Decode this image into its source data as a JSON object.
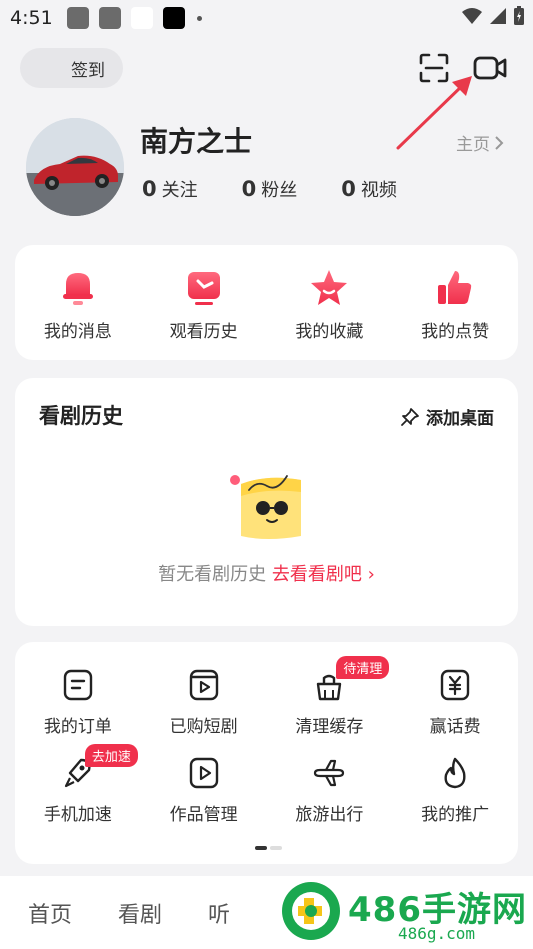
{
  "status_bar": {
    "time": "4:51"
  },
  "header": {
    "checkin_label": "签到"
  },
  "profile": {
    "username": "南方之士",
    "homepage_label": "主页",
    "stats": [
      {
        "value": "0",
        "label": "关注"
      },
      {
        "value": "0",
        "label": "粉丝"
      },
      {
        "value": "0",
        "label": "视频"
      }
    ]
  },
  "quick_actions": [
    {
      "label": "我的消息",
      "icon": "bell-icon"
    },
    {
      "label": "观看历史",
      "icon": "history-clock-icon"
    },
    {
      "label": "我的收藏",
      "icon": "star-icon"
    },
    {
      "label": "我的点赞",
      "icon": "thumbs-up-icon"
    }
  ],
  "history": {
    "title": "看剧历史",
    "add_desktop_label": "添加桌面",
    "empty_text": "暂无看剧历史",
    "go_link": "去看看剧吧"
  },
  "tools": [
    {
      "label": "我的订单",
      "icon": "order-icon"
    },
    {
      "label": "已购短剧",
      "icon": "purchased-drama-icon"
    },
    {
      "label": "清理缓存",
      "icon": "broom-icon",
      "badge": "待清理"
    },
    {
      "label": "赢话费",
      "icon": "yuan-icon"
    },
    {
      "label": "手机加速",
      "icon": "rocket-icon",
      "badge": "去加速"
    },
    {
      "label": "作品管理",
      "icon": "works-play-icon"
    },
    {
      "label": "旅游出行",
      "icon": "airplane-icon"
    },
    {
      "label": "我的推广",
      "icon": "flame-icon"
    }
  ],
  "bottom_nav": [
    {
      "label": "首页"
    },
    {
      "label": "看剧"
    },
    {
      "label": "听"
    }
  ],
  "watermark": {
    "text": "486手游网",
    "domain": "486g.com"
  },
  "colors": {
    "accent": "#f0304c",
    "background": "#f3f3f5",
    "card": "#ffffff",
    "watermark": "#1aa84f"
  }
}
